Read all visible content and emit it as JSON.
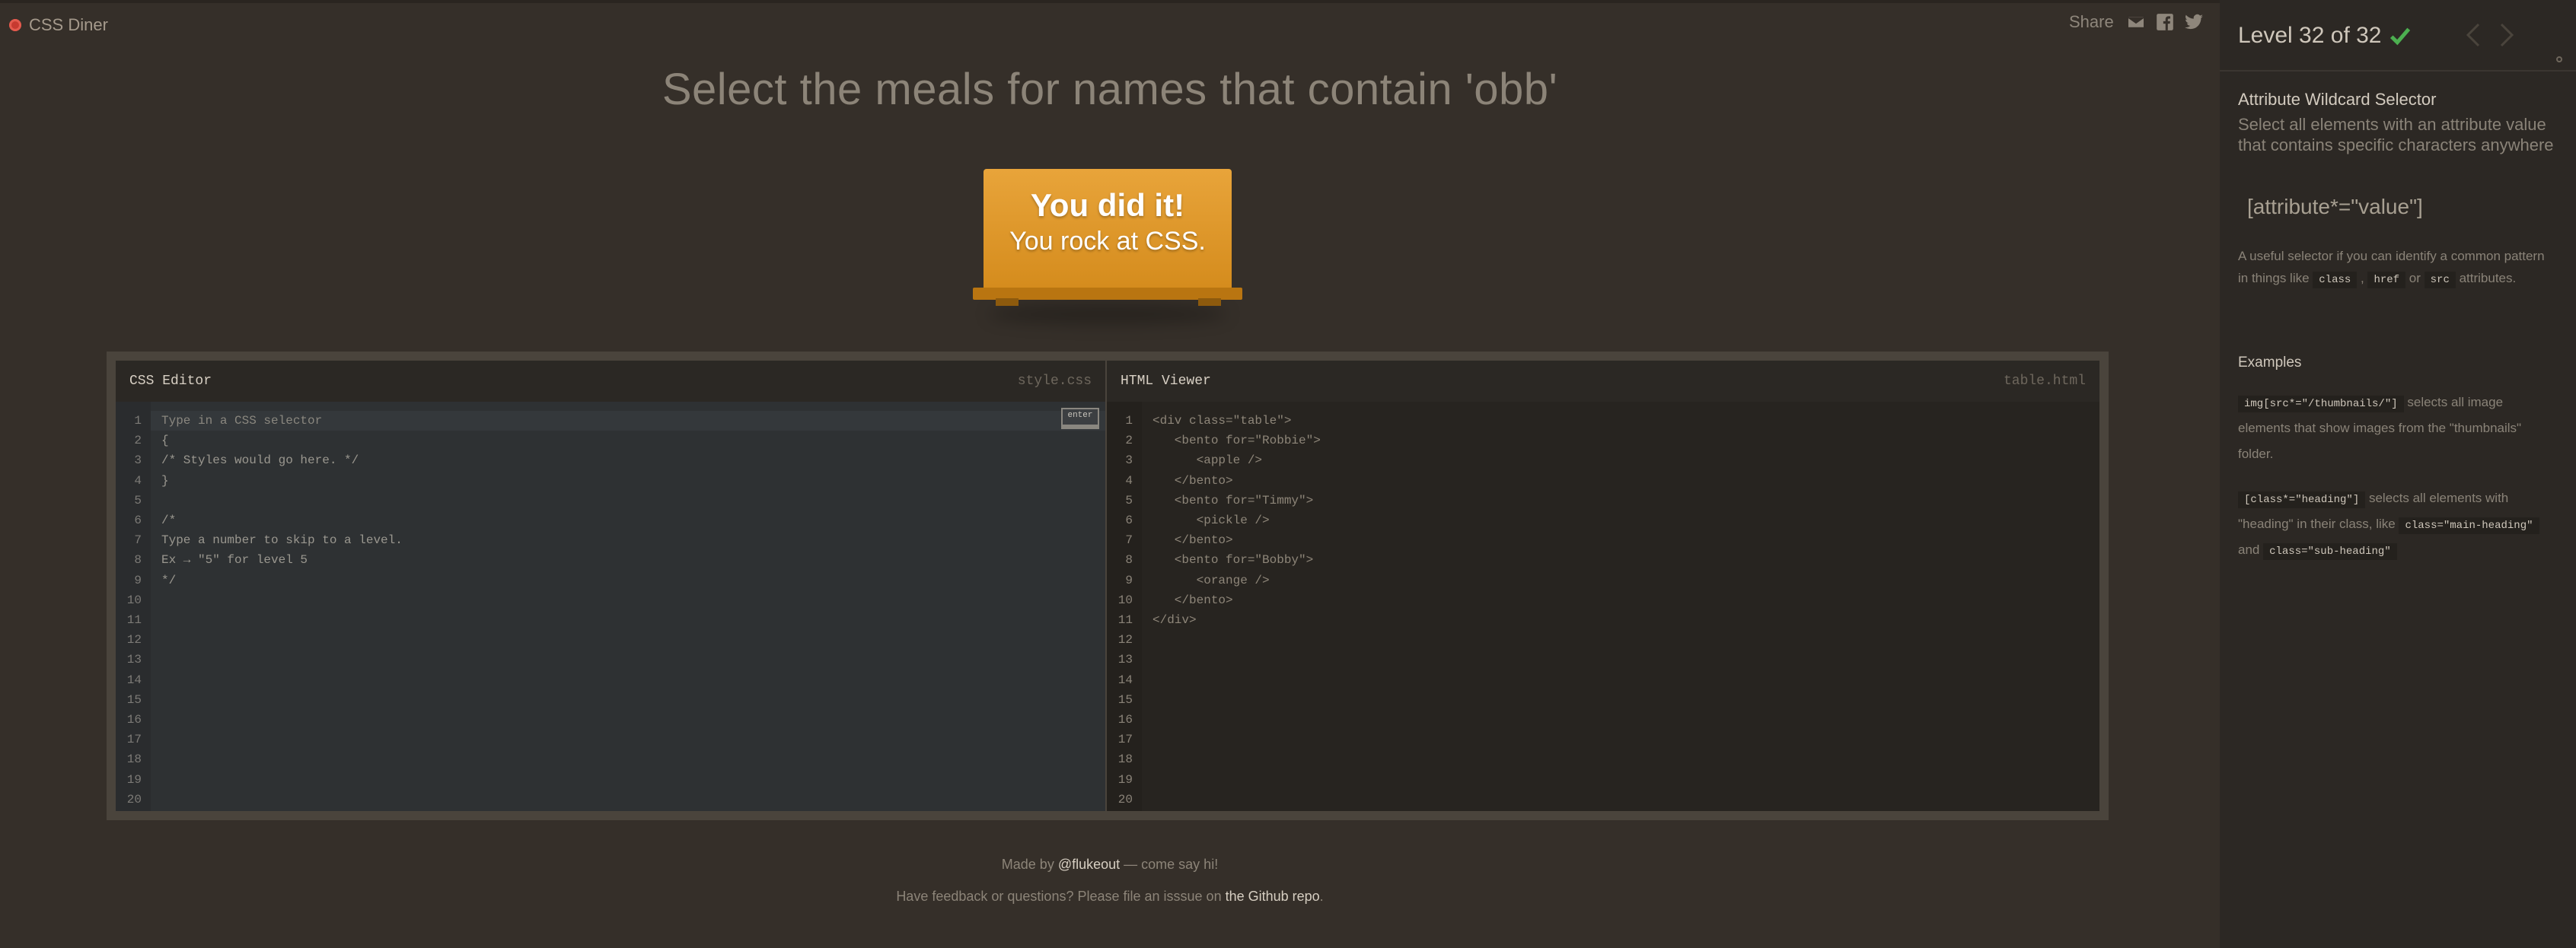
{
  "app": {
    "logo_text": "CSS Diner"
  },
  "share": {
    "label": "Share"
  },
  "order": {
    "text": "Select the meals for names that contain 'obb'"
  },
  "win_sign": {
    "line1": "You did it!",
    "line2": "You rock at CSS."
  },
  "editor": {
    "css_title": "CSS Editor",
    "css_file": "style.css",
    "html_title": "HTML Viewer",
    "html_file": "table.html",
    "input_placeholder": "Type in a CSS selector",
    "enter_label": "enter",
    "line_numbers": [
      "1",
      "2",
      "3",
      "4",
      "5",
      "6",
      "7",
      "8",
      "9",
      "10",
      "11",
      "12",
      "13",
      "14",
      "15",
      "16",
      "17",
      "18",
      "19",
      "20"
    ],
    "css_lines": [
      "",
      "{",
      "/* Styles would go here. */",
      "}",
      "",
      "/*",
      "Type a number to skip to a level.",
      "Ex → \"5\" for level 5",
      "*/"
    ],
    "html_lines": [
      "<div class=\"table\">",
      "   <bento for=\"Robbie\">",
      "      <apple />",
      "   </bento>",
      "   <bento for=\"Timmy\">",
      "      <pickle />",
      "   </bento>",
      "   <bento for=\"Bobby\">",
      "      <orange />",
      "   </bento>",
      "</div>"
    ]
  },
  "footer": {
    "made_by_prefix": "Made by ",
    "made_by_link": "@flukeout",
    "made_by_suffix": " — come say hi!",
    "feedback_prefix": "Have feedback or questions? Please file an isssue on ",
    "feedback_link": "the Github repo",
    "feedback_suffix": "."
  },
  "sidebar": {
    "level_text": "Level 32 of 32",
    "selector_name": "Attribute Wildcard Selector",
    "title": "Select all elements with an attribute value that contains specific characters anywhere",
    "syntax": "[attribute*=\"value\"]",
    "hint_prefix": "A useful selector if you can identify a common pattern in things like ",
    "hint_tag1": "class",
    "hint_sep1": " , ",
    "hint_tag2": "href",
    "hint_sep2": " or ",
    "hint_tag3": "src",
    "hint_suffix": " attributes.",
    "examples_title": "Examples",
    "ex1_tag": "img[src*=\"/thumbnails/\"]",
    "ex1_text": " selects all image elements that show images from the \"thumbnails\" folder.",
    "ex2_tag": "[class*=\"heading\"]",
    "ex2_text1": " selects all elements with \"heading\" in their class, like ",
    "ex2_tag2": "class=\"main-heading\"",
    "ex2_text2": " and ",
    "ex2_tag3": "class=\"sub-heading\"",
    "accent_color": "#4caf50"
  }
}
